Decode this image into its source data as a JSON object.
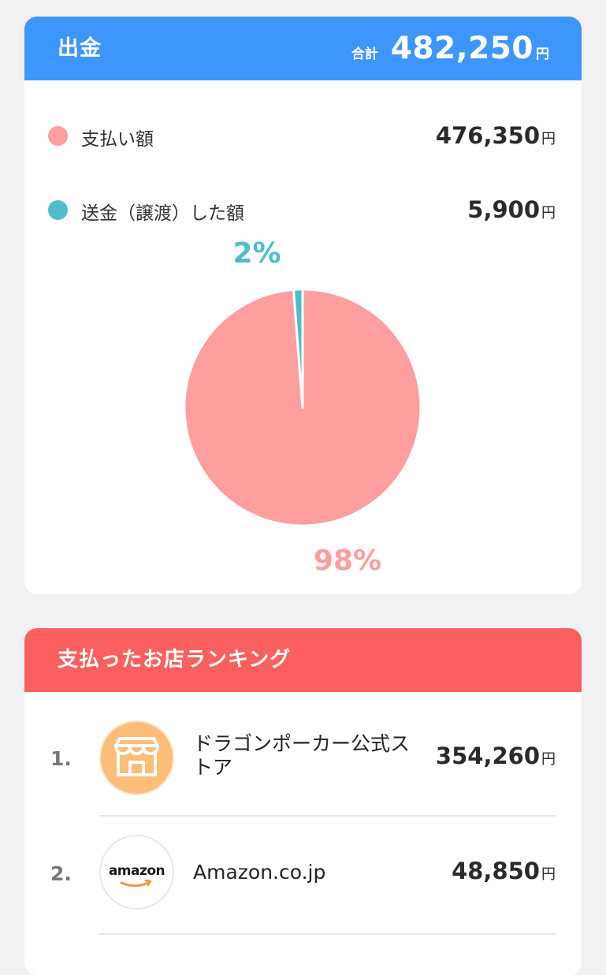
{
  "payout": {
    "title": "出金",
    "total_label": "合計",
    "total_value": "482,250",
    "total_unit": "円",
    "items": [
      {
        "label": "支払い額",
        "amount": "476,350",
        "unit": "円"
      },
      {
        "label": "送金（譲渡）した額",
        "amount": "5,900",
        "unit": "円"
      }
    ]
  },
  "chart_data": {
    "type": "pie",
    "slices": [
      {
        "label": "支払い額",
        "value": 476350,
        "percent_label": "98%",
        "color": "#ff9e9e"
      },
      {
        "label": "送金（譲渡）した額",
        "value": 5900,
        "percent_label": "2%",
        "color": "#4cbdc9"
      }
    ]
  },
  "ranking": {
    "title": "支払ったお店ランキング",
    "items": [
      {
        "rank": "1.",
        "name": "ドラゴンポーカー公式ストア",
        "amount": "354,260",
        "unit": "円",
        "icon": "store-icon",
        "icon_color": "#fbbd78"
      },
      {
        "rank": "2.",
        "name": "Amazon.co.jp",
        "amount": "48,850",
        "unit": "円",
        "icon": "amazon-logo",
        "logo_text": "amazon"
      }
    ]
  },
  "colors": {
    "header_blue": "#3d96fb",
    "header_red": "#fb5f5f",
    "payment": "#ff9e9e",
    "transfer": "#4cbdc9"
  }
}
